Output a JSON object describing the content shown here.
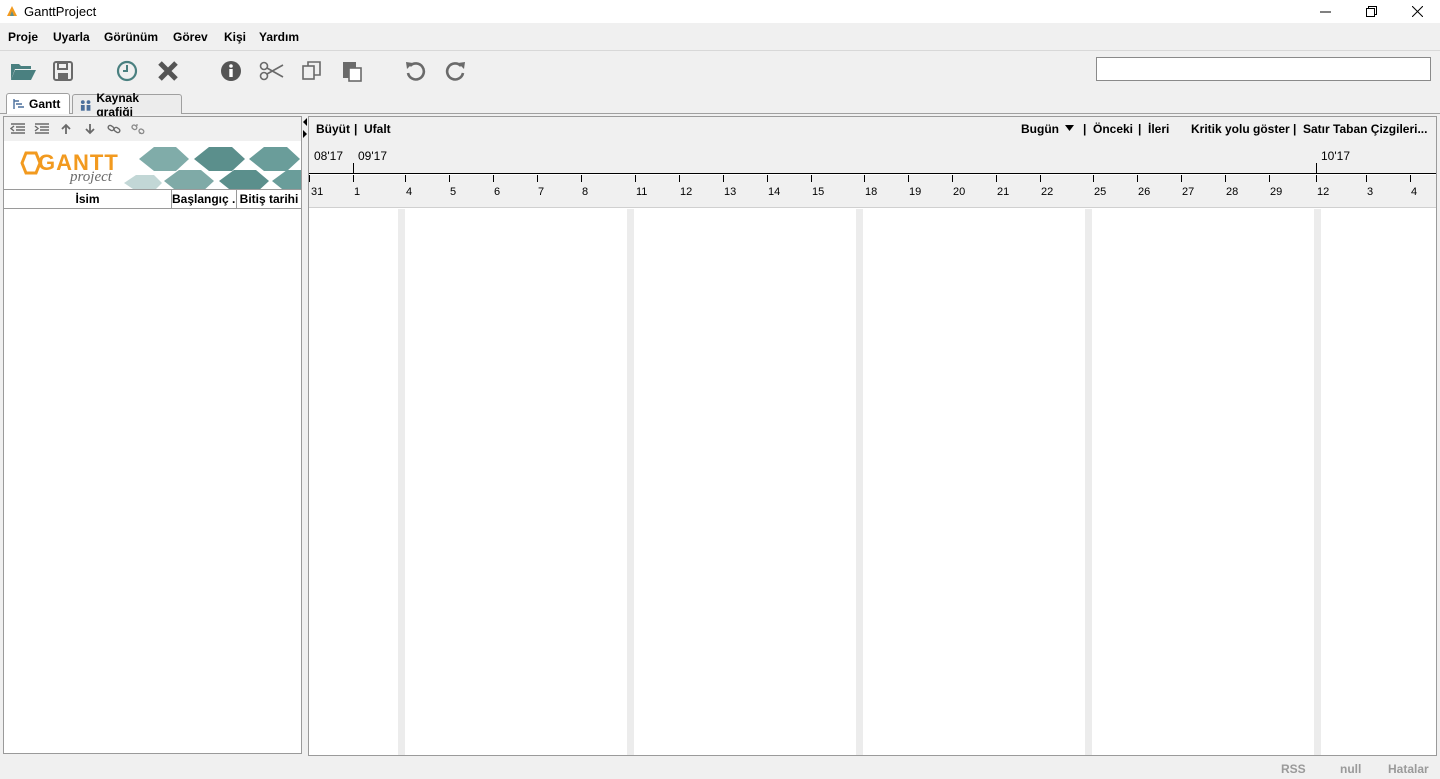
{
  "window": {
    "title": "GanttProject"
  },
  "menu": [
    "Proje",
    "Uyarla",
    "Görünüm",
    "Görev",
    "Kişi",
    "Yardım"
  ],
  "toolbar": {
    "icons": [
      "open-folder-icon",
      "save-icon",
      "clock-icon",
      "delete-icon",
      "info-icon",
      "cut-icon",
      "copy-icon",
      "paste-icon",
      "undo-icon",
      "redo-icon"
    ],
    "search_value": ""
  },
  "tabs": [
    {
      "label": "Gantt",
      "selected": true
    },
    {
      "label": "Kaynak grafiği",
      "selected": false
    }
  ],
  "task_tree": {
    "logo_text_main": "GANTT",
    "logo_text_sub": "project",
    "columns": [
      "İsim",
      "Başlangıç ...",
      "Bitiş tarihi"
    ],
    "rows": []
  },
  "chart_toolbar": {
    "zoom_in": "Büyüt",
    "separator": "|",
    "zoom_out": "Ufalt",
    "today": "Bugün",
    "previous": "Önceki",
    "next": "İleri",
    "critical_path": "Kritik yolu göster",
    "baselines": "Satır Taban Çizgileri..."
  },
  "timeline": {
    "months": [
      "08'17",
      "09'17",
      "10'17"
    ],
    "days": [
      "31",
      "1",
      "4",
      "5",
      "6",
      "7",
      "8",
      "11",
      "12",
      "13",
      "14",
      "15",
      "18",
      "19",
      "20",
      "21",
      "22",
      "25",
      "26",
      "27",
      "28",
      "29",
      "12",
      "3",
      "4"
    ]
  },
  "statusbar": {
    "rss": "RSS",
    "null_text": "null",
    "errors": "Hatalar"
  },
  "colors": {
    "background": "#f0f0f0",
    "logo_orange": "#f29a1f",
    "logo_teal": "#5b8f8c",
    "icon_teal": "#4a8080",
    "icon_gray": "#6a6a6a"
  }
}
